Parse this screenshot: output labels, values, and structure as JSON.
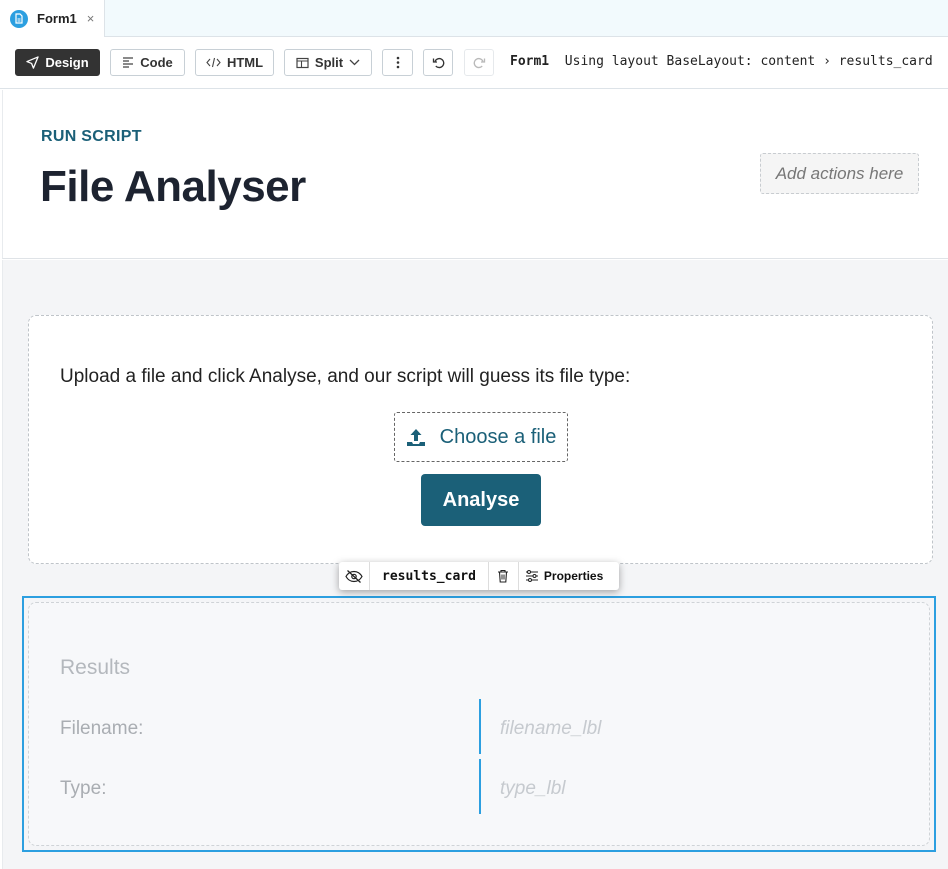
{
  "tab": {
    "label": "Form1",
    "close_glyph": "×",
    "icon": "form-file-icon"
  },
  "toolbar": {
    "design_label": "Design",
    "code_label": "Code",
    "html_label": "HTML",
    "split_label": "Split",
    "breadcrumb_form": "Form1",
    "breadcrumb_path": "Using layout BaseLayout: content › results_card"
  },
  "header": {
    "subtitle": "RUN SCRIPT",
    "title": "File Analyser",
    "actions_placeholder": "Add actions here"
  },
  "upload": {
    "instructions": "Upload a file and click Analyse, and our script will guess its file type:",
    "file_button": "Choose a file",
    "analyse_button": "Analyse"
  },
  "component_toolbar": {
    "name": "results_card",
    "properties_label": "Properties"
  },
  "results": {
    "title": "Results",
    "filename_label": "Filename:",
    "filename_value": "filename_lbl",
    "type_label": "Type:",
    "type_value": "type_lbl"
  },
  "colors": {
    "accent": "#1b6078",
    "selection": "#2c9fe0",
    "active_button": "#333333"
  }
}
